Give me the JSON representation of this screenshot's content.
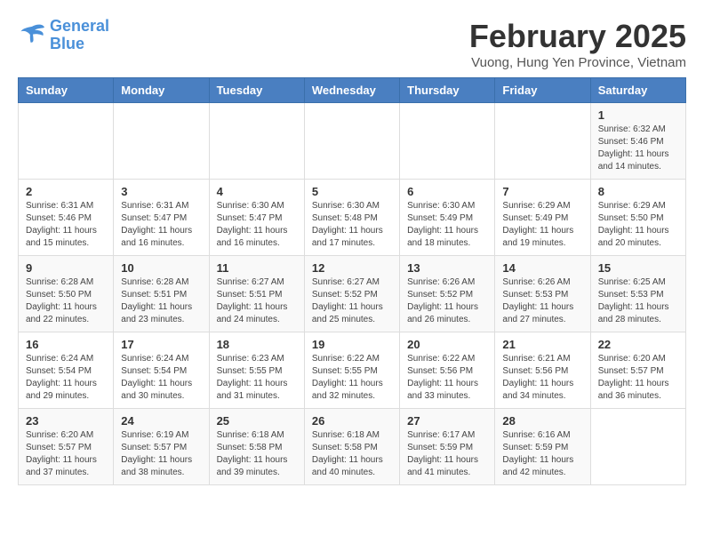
{
  "header": {
    "logo_line1": "General",
    "logo_line2": "Blue",
    "month_year": "February 2025",
    "location": "Vuong, Hung Yen Province, Vietnam"
  },
  "weekdays": [
    "Sunday",
    "Monday",
    "Tuesday",
    "Wednesday",
    "Thursday",
    "Friday",
    "Saturday"
  ],
  "weeks": [
    [
      {
        "num": "",
        "detail": ""
      },
      {
        "num": "",
        "detail": ""
      },
      {
        "num": "",
        "detail": ""
      },
      {
        "num": "",
        "detail": ""
      },
      {
        "num": "",
        "detail": ""
      },
      {
        "num": "",
        "detail": ""
      },
      {
        "num": "1",
        "detail": "Sunrise: 6:32 AM\nSunset: 5:46 PM\nDaylight: 11 hours\nand 14 minutes."
      }
    ],
    [
      {
        "num": "2",
        "detail": "Sunrise: 6:31 AM\nSunset: 5:46 PM\nDaylight: 11 hours\nand 15 minutes."
      },
      {
        "num": "3",
        "detail": "Sunrise: 6:31 AM\nSunset: 5:47 PM\nDaylight: 11 hours\nand 16 minutes."
      },
      {
        "num": "4",
        "detail": "Sunrise: 6:30 AM\nSunset: 5:47 PM\nDaylight: 11 hours\nand 16 minutes."
      },
      {
        "num": "5",
        "detail": "Sunrise: 6:30 AM\nSunset: 5:48 PM\nDaylight: 11 hours\nand 17 minutes."
      },
      {
        "num": "6",
        "detail": "Sunrise: 6:30 AM\nSunset: 5:49 PM\nDaylight: 11 hours\nand 18 minutes."
      },
      {
        "num": "7",
        "detail": "Sunrise: 6:29 AM\nSunset: 5:49 PM\nDaylight: 11 hours\nand 19 minutes."
      },
      {
        "num": "8",
        "detail": "Sunrise: 6:29 AM\nSunset: 5:50 PM\nDaylight: 11 hours\nand 20 minutes."
      }
    ],
    [
      {
        "num": "9",
        "detail": "Sunrise: 6:28 AM\nSunset: 5:50 PM\nDaylight: 11 hours\nand 22 minutes."
      },
      {
        "num": "10",
        "detail": "Sunrise: 6:28 AM\nSunset: 5:51 PM\nDaylight: 11 hours\nand 23 minutes."
      },
      {
        "num": "11",
        "detail": "Sunrise: 6:27 AM\nSunset: 5:51 PM\nDaylight: 11 hours\nand 24 minutes."
      },
      {
        "num": "12",
        "detail": "Sunrise: 6:27 AM\nSunset: 5:52 PM\nDaylight: 11 hours\nand 25 minutes."
      },
      {
        "num": "13",
        "detail": "Sunrise: 6:26 AM\nSunset: 5:52 PM\nDaylight: 11 hours\nand 26 minutes."
      },
      {
        "num": "14",
        "detail": "Sunrise: 6:26 AM\nSunset: 5:53 PM\nDaylight: 11 hours\nand 27 minutes."
      },
      {
        "num": "15",
        "detail": "Sunrise: 6:25 AM\nSunset: 5:53 PM\nDaylight: 11 hours\nand 28 minutes."
      }
    ],
    [
      {
        "num": "16",
        "detail": "Sunrise: 6:24 AM\nSunset: 5:54 PM\nDaylight: 11 hours\nand 29 minutes."
      },
      {
        "num": "17",
        "detail": "Sunrise: 6:24 AM\nSunset: 5:54 PM\nDaylight: 11 hours\nand 30 minutes."
      },
      {
        "num": "18",
        "detail": "Sunrise: 6:23 AM\nSunset: 5:55 PM\nDaylight: 11 hours\nand 31 minutes."
      },
      {
        "num": "19",
        "detail": "Sunrise: 6:22 AM\nSunset: 5:55 PM\nDaylight: 11 hours\nand 32 minutes."
      },
      {
        "num": "20",
        "detail": "Sunrise: 6:22 AM\nSunset: 5:56 PM\nDaylight: 11 hours\nand 33 minutes."
      },
      {
        "num": "21",
        "detail": "Sunrise: 6:21 AM\nSunset: 5:56 PM\nDaylight: 11 hours\nand 34 minutes."
      },
      {
        "num": "22",
        "detail": "Sunrise: 6:20 AM\nSunset: 5:57 PM\nDaylight: 11 hours\nand 36 minutes."
      }
    ],
    [
      {
        "num": "23",
        "detail": "Sunrise: 6:20 AM\nSunset: 5:57 PM\nDaylight: 11 hours\nand 37 minutes."
      },
      {
        "num": "24",
        "detail": "Sunrise: 6:19 AM\nSunset: 5:57 PM\nDaylight: 11 hours\nand 38 minutes."
      },
      {
        "num": "25",
        "detail": "Sunrise: 6:18 AM\nSunset: 5:58 PM\nDaylight: 11 hours\nand 39 minutes."
      },
      {
        "num": "26",
        "detail": "Sunrise: 6:18 AM\nSunset: 5:58 PM\nDaylight: 11 hours\nand 40 minutes."
      },
      {
        "num": "27",
        "detail": "Sunrise: 6:17 AM\nSunset: 5:59 PM\nDaylight: 11 hours\nand 41 minutes."
      },
      {
        "num": "28",
        "detail": "Sunrise: 6:16 AM\nSunset: 5:59 PM\nDaylight: 11 hours\nand 42 minutes."
      },
      {
        "num": "",
        "detail": ""
      }
    ]
  ]
}
